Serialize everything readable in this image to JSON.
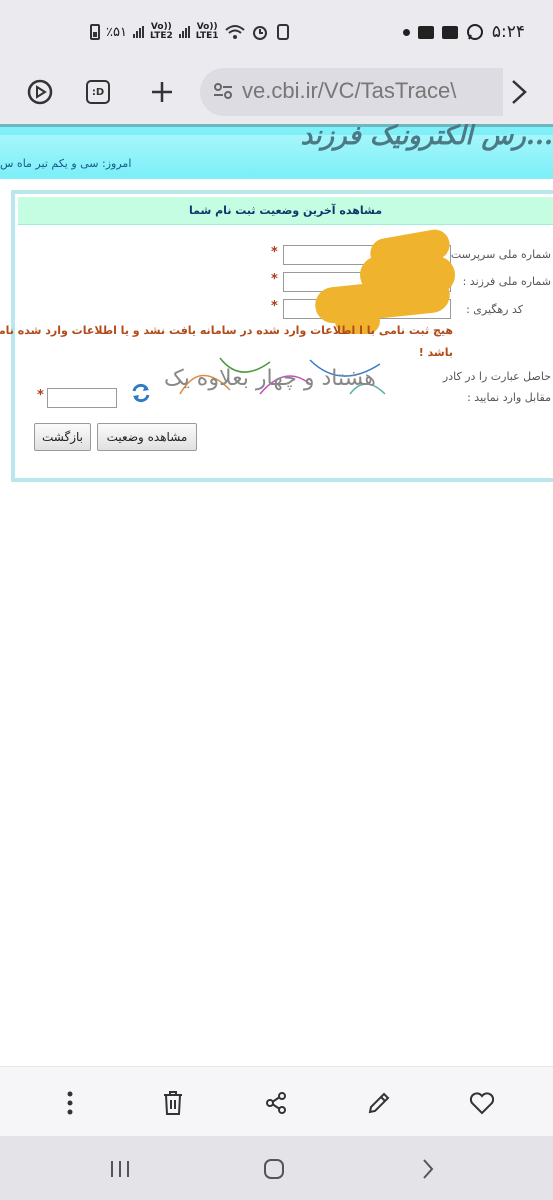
{
  "status_bar": {
    "battery": "٪۵۱",
    "sim1": "LTE2",
    "sim2": "LTE1",
    "volte": "Vo))",
    "time": "۵:۲۴"
  },
  "browser": {
    "url": "ve.cbi.ir/VC/TasTrace\\",
    "tab_label": ":D"
  },
  "page": {
    "logo_text": "...رس الکترونیک فرزند",
    "date_prefix": "امروز:",
    "date_value": "سی و یکم تیر ماه س",
    "form_title": "مشاهده آخرین وضعیت ثبت نام شما",
    "fields": [
      {
        "label": "شماره ملی سرپرست :",
        "star": "*"
      },
      {
        "label": "شماره ملی فرزند :",
        "star": "*"
      },
      {
        "label": "کد رهگیری :",
        "star": "*"
      }
    ],
    "error_line1": "هیچ ثبت نامی با ا     اطلاعات وارد شده در سامانه یافت نشد و یا اطلاعات وارد شده نامعتبر می",
    "error_line2": "باشد !",
    "captcha_label_1": "حاصل عبارت را در کادر",
    "captcha_label_2": "مقابل وارد نمایید :",
    "captcha_text": "هشتاد و چهار بعلاوه یک",
    "captcha_star": "*",
    "buttons": {
      "status": "مشاهده وضعیت",
      "back": "بازگشت"
    }
  },
  "colors": {
    "header": "#7ff0f8",
    "title_bar": "#c5fde2",
    "error": "#b24a1a",
    "redaction": "#f0b32e"
  }
}
